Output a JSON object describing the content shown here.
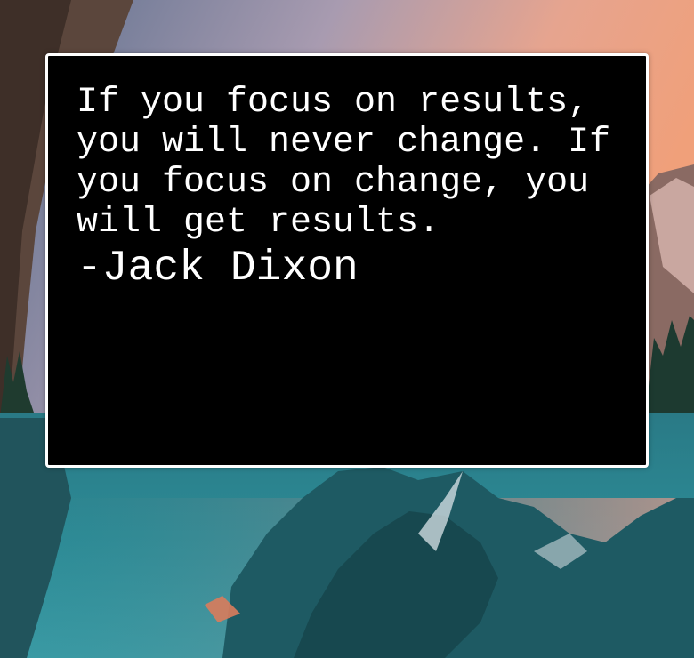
{
  "quote": {
    "text": "If you focus on results, you will never change. If you focus on change, you will get results.",
    "author": "-Jack Dixon"
  },
  "colors": {
    "card_background": "#000000",
    "card_border": "#ffffff",
    "text": "#ffffff",
    "sky_top": "#6a7fa0",
    "sky_glow": "#e99a84",
    "lake": "#2d7f88"
  }
}
